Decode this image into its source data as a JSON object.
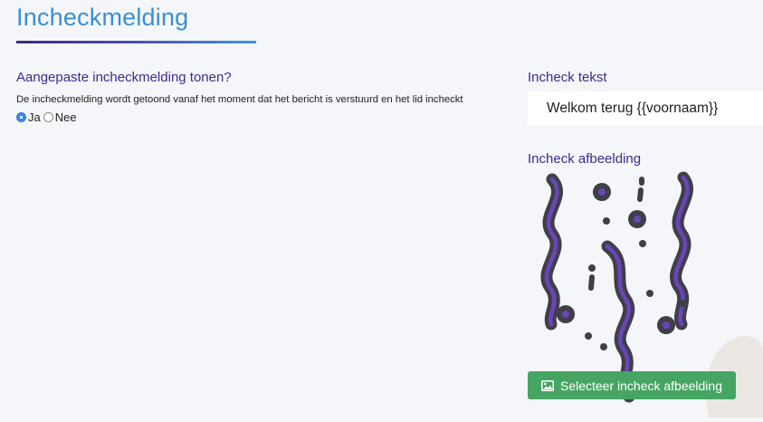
{
  "page": {
    "title": "Incheckmelding"
  },
  "checkin_toggle": {
    "question": "Aangepaste incheckmelding tonen?",
    "help": "De incheckmelding wordt getoond vanaf het moment dat het bericht is verstuurd en het lid incheckt",
    "options": [
      {
        "label": "Ja",
        "selected": true
      },
      {
        "label": "Nee",
        "selected": false
      }
    ]
  },
  "checkin_text": {
    "label": "Incheck tekst",
    "value": "Welkom terug {{voornaam}}"
  },
  "checkin_image": {
    "label": "Incheck afbeelding",
    "illustration_icon": "confetti-streamers-icon",
    "button_icon": "image-icon",
    "button_label": "Selecteer incheck afbeelding"
  },
  "colors": {
    "accent_blue": "#3a8fd3",
    "heading_purple": "#3e2a8c",
    "button_green": "#47a563",
    "streamer_dark": "#3f3f4a",
    "streamer_purple": "#6a45b8"
  }
}
